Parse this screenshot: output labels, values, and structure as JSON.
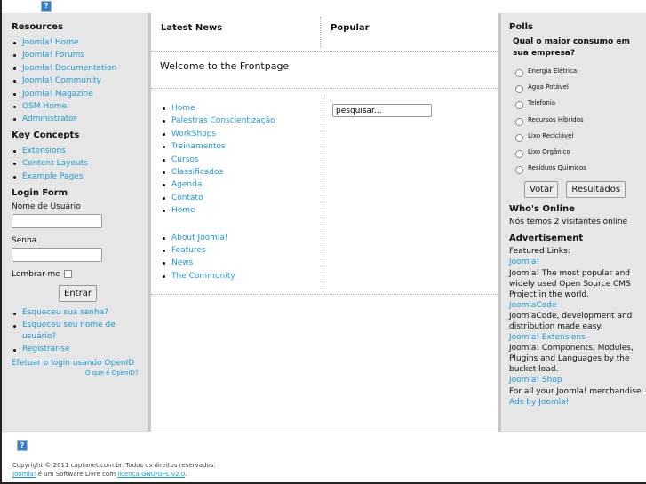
{
  "left": {
    "resources_title": "Resources",
    "resources": [
      "Joomla! Home",
      "Joomla! Forums",
      "Joomla! Documentation",
      "Joomla! Community",
      "Joomla! Magazine",
      "OSM Home",
      "Administrator"
    ],
    "key_title": "Key Concepts",
    "key": [
      "Extensions",
      "Content Layouts",
      "Example Pages"
    ],
    "login_title": "Login Form",
    "user_label": "Nome de Usuário",
    "user_value": "",
    "pass_label": "Senha",
    "pass_value": "",
    "remember_label": "Lembrar-me",
    "login_button": "Entrar",
    "login_links": [
      "Esqueceu sua senha?",
      "Esqueceu seu nome de usuário?",
      "Registrar-se"
    ],
    "openid": "Efetuar o login usando OpenID",
    "openid_what": "O que é OpenID?"
  },
  "center": {
    "latest_news": "Latest News",
    "popular": "Popular",
    "welcome": "Welcome to the Frontpage",
    "menu1": [
      "Home",
      "Palestras Conscientização",
      "WorkShops",
      "Treinamentos",
      "Cursos",
      "Classificados",
      "Agenda",
      "Contato",
      "Home"
    ],
    "menu2": [
      "About Joomla!",
      "Features",
      "News",
      "The Community"
    ],
    "search_value": "pesquisar..."
  },
  "right": {
    "polls_title": "Polls",
    "question": "Qual o maior consumo em sua empresa?",
    "options": [
      "Energia Elétrica",
      "Agua Potável",
      "Telefonia",
      "Recursos Híbridos",
      "Lixo Reciclável",
      "Lixo Orgânico",
      "Resíduos Quimicos"
    ],
    "vote_button": "Votar",
    "results_button": "Resultados",
    "online_title": "Who's Online",
    "online_text": "Nós temos 2 visitantes online",
    "ad_title": "Advertisement",
    "featured": "Featured Links:",
    "ads": [
      {
        "link": "Joomla!",
        "text": "Joomla! The most popular and widely used Open Source CMS Project in the world."
      },
      {
        "link": "JoomlaCode",
        "text": "JoomlaCode, development and distribution made easy."
      },
      {
        "link": "Joomla! Extensions",
        "text": "Joomla! Components, Modules, Plugins and Languages by the bucket load."
      },
      {
        "link": "Joomla! Shop",
        "text": "For all your Joomla! merchandise."
      }
    ],
    "ads_by": "Ads by Joomla!"
  },
  "footer": {
    "copyright": "Copyright © 2011 captanet.com.br. Todos os direitos reservados.",
    "joomla": "Joomla!",
    "mid": " é um Software Livre com ",
    "license": "licença GNU/GPL v2.0",
    "end": "."
  }
}
